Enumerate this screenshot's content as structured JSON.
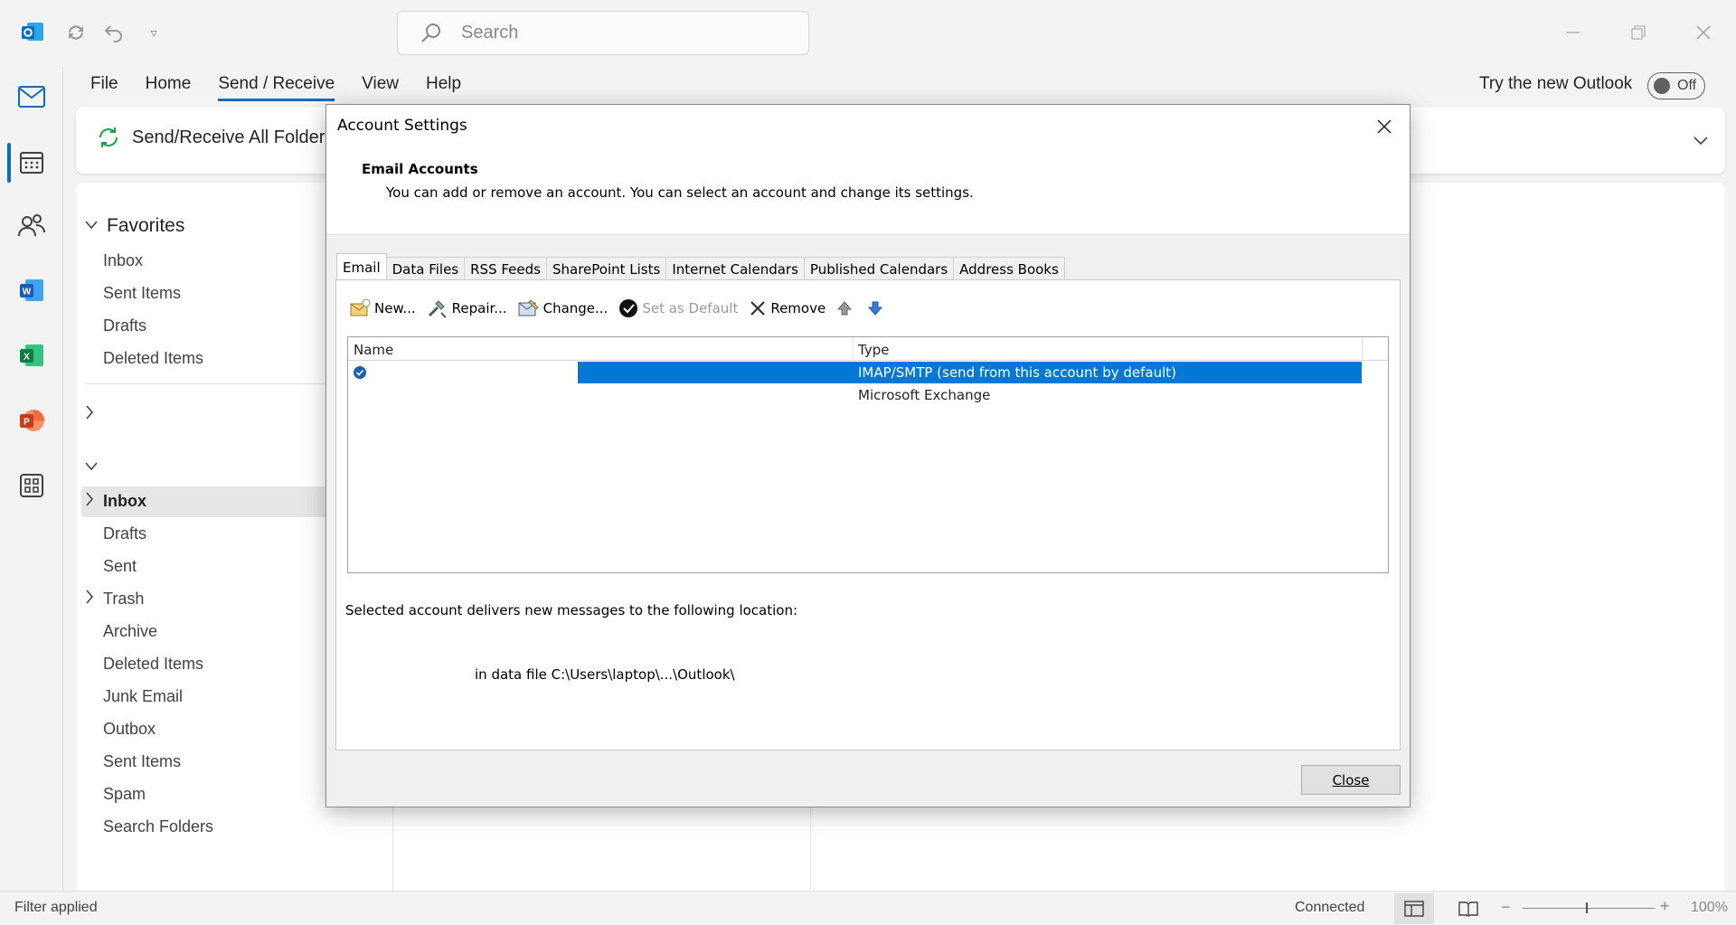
{
  "titlebar": {
    "search_placeholder": "Search"
  },
  "menu": {
    "items": [
      "File",
      "Home",
      "Send / Receive",
      "View",
      "Help"
    ],
    "active_index": 2,
    "try_new": "Try the new Outlook",
    "toggle_state": "Off"
  },
  "ribbon": {
    "send_receive_all": "Send/Receive All Folders"
  },
  "folders": {
    "favorites_label": "Favorites",
    "favorites": [
      "Inbox",
      "Sent Items",
      "Drafts",
      "Deleted Items"
    ],
    "account_folders": [
      "Inbox",
      "Drafts",
      "Sent",
      "Trash",
      "Archive",
      "Deleted Items",
      "Junk Email",
      "Outbox",
      "Sent Items",
      "Spam",
      "Search Folders"
    ]
  },
  "status": {
    "filter": "Filter applied",
    "connection": "Connected",
    "zoom": "100%"
  },
  "dialog": {
    "title": "Account Settings",
    "heading": "Email Accounts",
    "description": "You can add or remove an account. You can select an account and change its settings.",
    "tabs": [
      "Email",
      "Data Files",
      "RSS Feeds",
      "SharePoint Lists",
      "Internet Calendars",
      "Published Calendars",
      "Address Books"
    ],
    "active_tab": 0,
    "toolbar": {
      "new": "New...",
      "repair": "Repair...",
      "change": "Change...",
      "set_default": "Set as Default",
      "remove": "Remove"
    },
    "list": {
      "col_name": "Name",
      "col_type": "Type",
      "rows": [
        {
          "name": "",
          "type": "IMAP/SMTP (send from this account by default)",
          "selected": true,
          "default": true
        },
        {
          "name": "",
          "type": "Microsoft Exchange",
          "selected": false,
          "default": false
        }
      ]
    },
    "deliver_label": "Selected account delivers new messages to the following location:",
    "data_file": "in data file C:\\Users\\laptop\\...\\Outlook\\",
    "close_label": "Close"
  },
  "colors": {
    "accent": "#0f6cbd",
    "selection": "#0078d7"
  }
}
